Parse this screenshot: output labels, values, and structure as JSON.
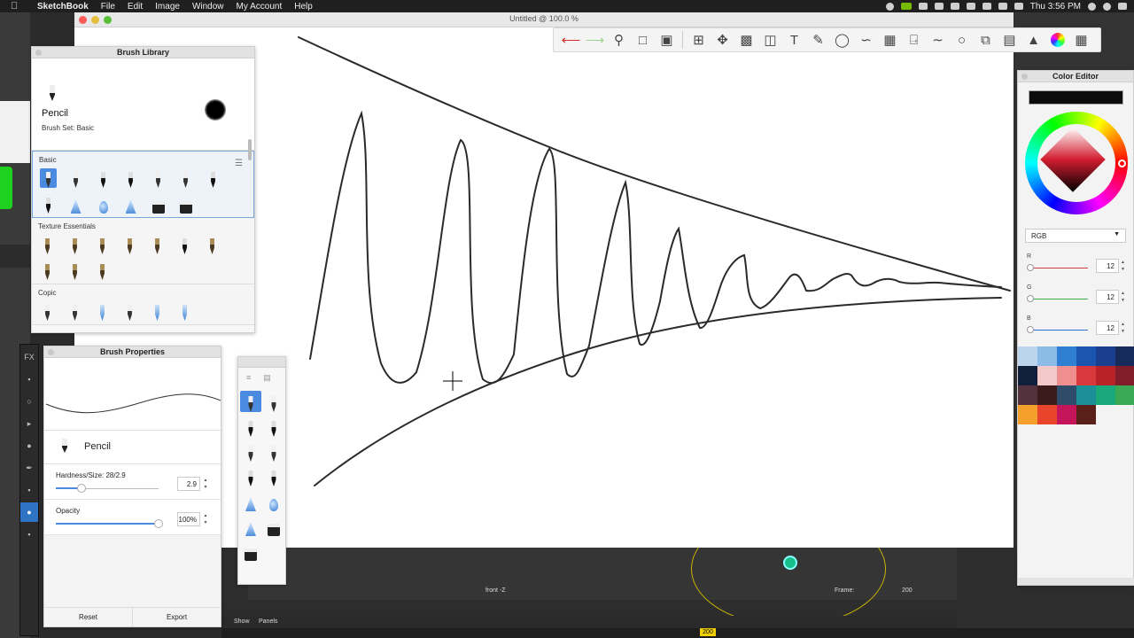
{
  "menubar": {
    "app_name": "SketchBook",
    "menus": [
      "File",
      "Edit",
      "Image",
      "Window",
      "My Account",
      "Help"
    ],
    "clock": "Thu 3:56 PM"
  },
  "window": {
    "title": "Untitled @ 100.0 %"
  },
  "toolbar": {
    "tools": [
      "undo-icon",
      "redo-icon",
      "zoom-icon",
      "select-icon",
      "lasso-icon",
      "crop-icon",
      "transform-icon",
      "distort-icon",
      "fill-icon",
      "text-icon",
      "ruler-icon",
      "ellipse-icon",
      "french-curve-icon",
      "perspective-icon",
      "symmetry-icon",
      "curve-icon",
      "circle-icon",
      "copy-paste-icon",
      "layer-icon",
      "brush-icon",
      "color-wheel-icon",
      "grid-icon"
    ]
  },
  "brush_library": {
    "title": "Brush Library",
    "current_brush": "Pencil",
    "brush_set": "Brush Set: Basic",
    "sections": [
      {
        "name": "Basic"
      },
      {
        "name": "Texture Essentials"
      },
      {
        "name": "Copic"
      }
    ]
  },
  "brush_properties": {
    "title": "Brush Properties",
    "brush_name": "Pencil",
    "hardness_label": "Hardness/Size: 28/2.9",
    "hardness_value": "2.9",
    "hardness_fraction": 0.25,
    "opacity_label": "Opacity",
    "opacity_value": "100%",
    "opacity_fraction": 1.0,
    "reset_label": "Reset",
    "export_label": "Export"
  },
  "color_editor": {
    "title": "Color Editor",
    "current_color": "#0c0c0c",
    "mode": "RGB",
    "r_label": "R",
    "g_label": "G",
    "b_label": "B",
    "r_value": "12",
    "g_value": "12",
    "b_value": "12",
    "palette": [
      "#bcd5ee",
      "#8dbbe8",
      "#2f7fd2",
      "#1c55b0",
      "#1b3f8f",
      "#162b59",
      "#0f1f3c",
      "#f2c8c8",
      "#ef8e8e",
      "#d9383c",
      "#b8232a",
      "#7f1d28",
      "#53323e",
      "#3a1a1a",
      "#2f4b6a",
      "#1d8f99",
      "#1aa87a",
      "#3aa855",
      "#f5a02a",
      "#e8452c",
      "#c4145a",
      "#5a1f18"
    ]
  },
  "background_app": {
    "viewport_label": "front -Z",
    "frame_label": "Frame:",
    "frame_value": "200",
    "tabs": [
      "Show",
      "Panels"
    ]
  }
}
